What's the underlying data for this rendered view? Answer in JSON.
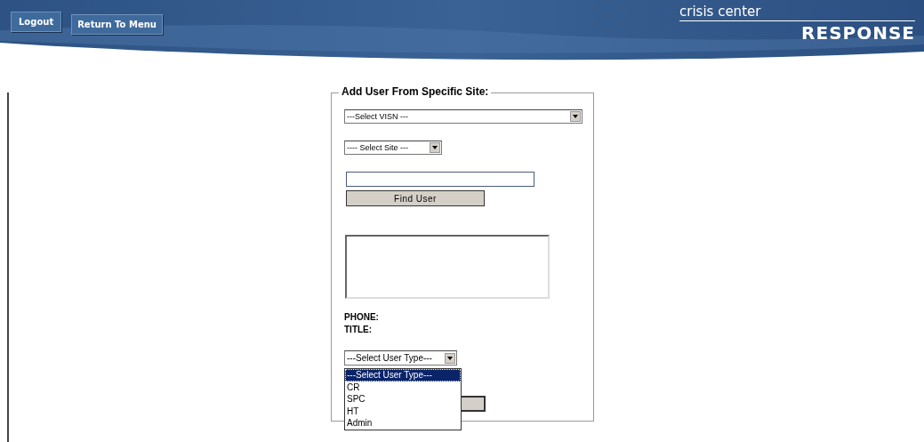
{
  "header": {
    "buttons": [
      "Logout",
      "Return To Menu"
    ],
    "logo": {
      "line_1": "crisis center",
      "line_2": "RESPONSE"
    }
  },
  "form": {
    "legend": "Add User From Specific Site:",
    "visn_select": {
      "value": "---Select VISN ---"
    },
    "site_select": {
      "value": "---- Select Site ---"
    },
    "find_button": "Find User",
    "labels": [
      "PHONE:",
      "TITLE:"
    ],
    "user_type_select": {
      "value": "---Select User Type---",
      "expanded": true,
      "options": [
        {
          "label": "---Select User Type---",
          "selected": true
        },
        {
          "label": "CR",
          "selected": false
        },
        {
          "label": "SPC",
          "selected": false
        },
        {
          "label": "HT",
          "selected": false
        },
        {
          "label": "Admin",
          "selected": false
        }
      ]
    }
  }
}
